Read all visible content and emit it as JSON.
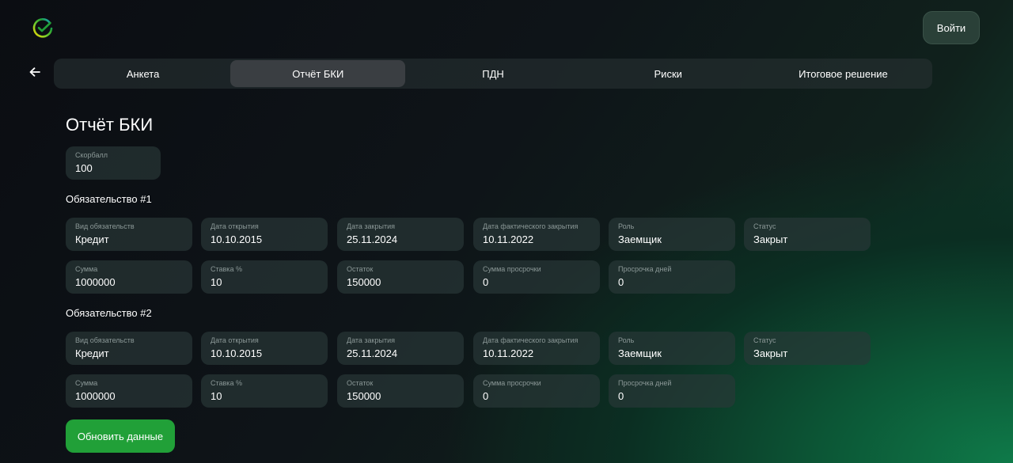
{
  "header": {
    "logo_icon": "sber-check-logo-icon",
    "login_label": "Войти"
  },
  "nav": {
    "back_icon": "arrow-left-icon",
    "tabs": [
      {
        "label": "Анкета",
        "active": false
      },
      {
        "label": "Отчёт БКИ",
        "active": true
      },
      {
        "label": "ПДН",
        "active": false
      },
      {
        "label": "Риски",
        "active": false
      },
      {
        "label": "Итоговое решение",
        "active": false
      }
    ]
  },
  "main": {
    "title": "Отчёт БКИ",
    "score": {
      "label": "Скорбалл",
      "value": "100"
    },
    "obligations": [
      {
        "title": "Обязательство #1",
        "type": {
          "label": "Вид обязательств",
          "value": "Кредит"
        },
        "open_date": {
          "label": "Дата открытия",
          "value": "10.10.2015"
        },
        "close_date": {
          "label": "Дата закрытия",
          "value": "25.11.2024"
        },
        "actual_close_date": {
          "label": "Дата фактического закрытия",
          "value": "10.11.2022"
        },
        "role": {
          "label": "Роль",
          "value": "Заемщик"
        },
        "status": {
          "label": "Статус",
          "value": "Закрыт"
        },
        "amount": {
          "label": "Сумма",
          "value": "1000000"
        },
        "rate": {
          "label": "Ставка %",
          "value": "10"
        },
        "balance": {
          "label": "Остаток",
          "value": "150000"
        },
        "overdue_amount": {
          "label": "Сумма просрочки",
          "value": "0"
        },
        "overdue_days": {
          "label": "Просрочка дней",
          "value": "0"
        }
      },
      {
        "title": "Обязательство #2",
        "type": {
          "label": "Вид обязательств",
          "value": "Кредит"
        },
        "open_date": {
          "label": "Дата открытия",
          "value": "10.10.2015"
        },
        "close_date": {
          "label": "Дата закрытия",
          "value": "25.11.2024"
        },
        "actual_close_date": {
          "label": "Дата фактического закрытия",
          "value": "10.11.2022"
        },
        "role": {
          "label": "Роль",
          "value": "Заемщик"
        },
        "status": {
          "label": "Статус",
          "value": "Закрыт"
        },
        "amount": {
          "label": "Сумма",
          "value": "1000000"
        },
        "rate": {
          "label": "Ставка %",
          "value": "10"
        },
        "balance": {
          "label": "Остаток",
          "value": "150000"
        },
        "overdue_amount": {
          "label": "Сумма просрочки",
          "value": "0"
        },
        "overdue_days": {
          "label": "Просрочка дней",
          "value": "0"
        }
      }
    ],
    "refresh_label": "Обновить данные"
  },
  "colors": {
    "accent": "#21a038",
    "field_bg": "#2a3838",
    "active_tab_bg": "#3a3e42"
  }
}
